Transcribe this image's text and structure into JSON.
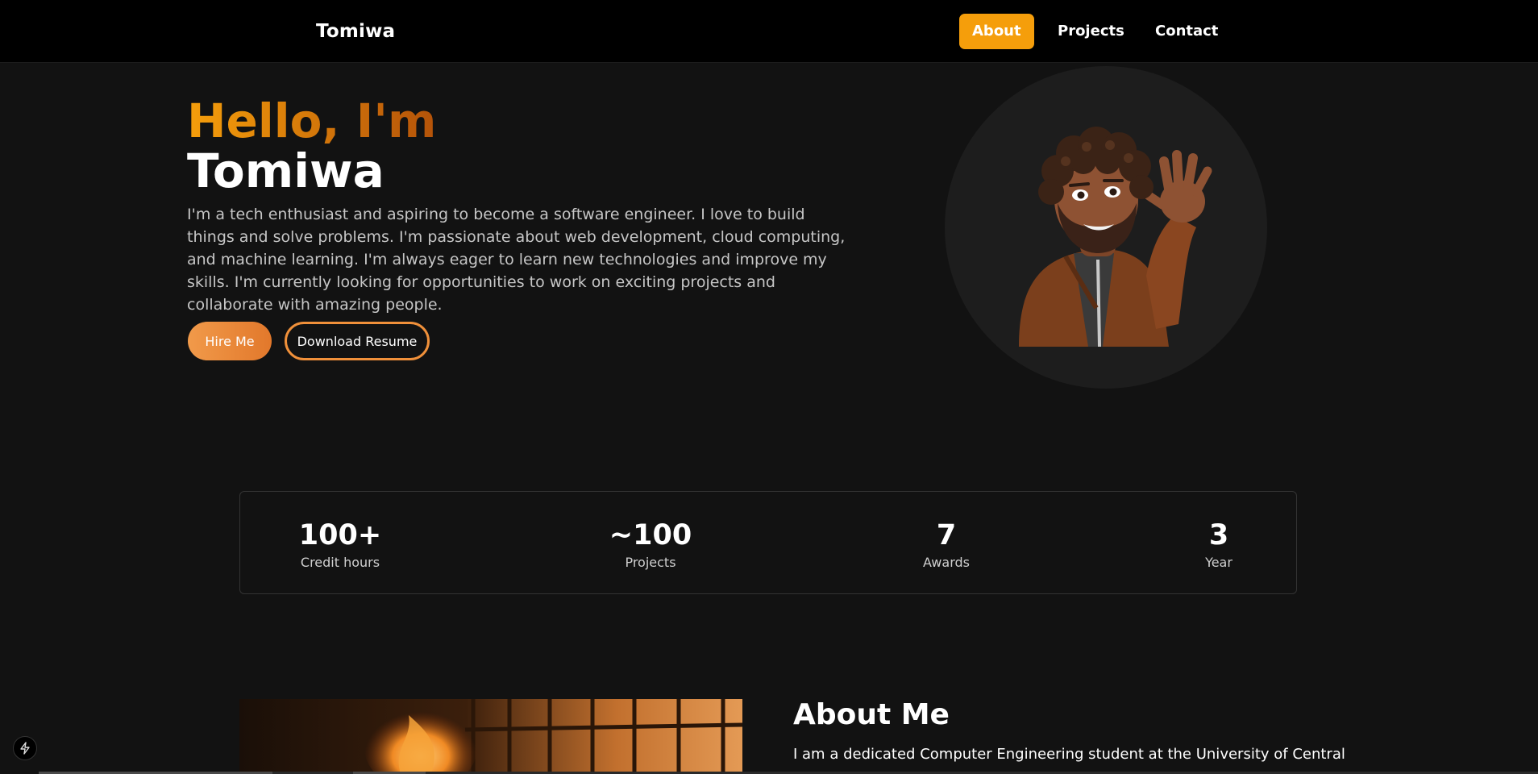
{
  "nav": {
    "brand": "Tomiwa",
    "links": [
      {
        "label": "About",
        "active": true
      },
      {
        "label": "Projects",
        "active": false
      },
      {
        "label": "Contact",
        "active": false
      }
    ]
  },
  "hero": {
    "greeting": "Hello, I'm",
    "name": "Tomiwa",
    "bio": "I'm a tech enthusiast and aspiring to become a software engineer. I love to build things and solve problems. I'm passionate about web development, cloud computing, and machine learning. I'm always eager to learn new technologies and improve my skills. I'm currently looking for opportunities to work on exciting projects and collaborate with amazing people.",
    "hire_label": "Hire Me",
    "resume_label": "Download Resume",
    "avatar_icon": "waving-memoji-avatar"
  },
  "stats": [
    {
      "value": "100+",
      "label": "Credit hours"
    },
    {
      "value": "~100",
      "label": "Projects"
    },
    {
      "value": "7",
      "label": "Awards"
    },
    {
      "value": "3",
      "label": "Year"
    }
  ],
  "about": {
    "title": "About Me",
    "text": "I am a dedicated Computer Engineering student at the University of Central",
    "image_icon": "fire-window-photo"
  },
  "badge_icon": "lightning-icon",
  "colors": {
    "accent": "#f59e0b",
    "accent_dark": "#b45309",
    "button_orange": "#e2782b",
    "background": "#121212",
    "nav_background": "#000000"
  }
}
